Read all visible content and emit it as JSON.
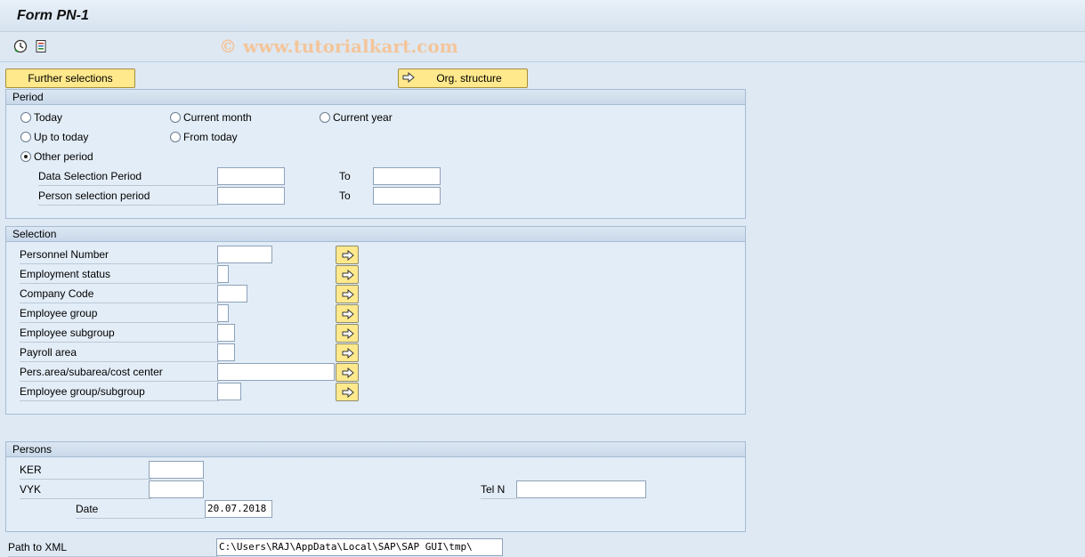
{
  "title": "Form PN-1",
  "watermark": "© www.tutorialkart.com",
  "toolbar": {
    "execute_icon": "execute-clock-icon",
    "variant_icon": "variant-list-icon"
  },
  "buttons": {
    "further_selections": "Further selections",
    "org_structure": "Org. structure"
  },
  "period": {
    "header": "Period",
    "options": {
      "today": "Today",
      "current_month": "Current month",
      "current_year": "Current year",
      "up_to_today": "Up to today",
      "from_today": "From today",
      "other_period": "Other period"
    },
    "selected": "other_period",
    "data_selection_label": "Data Selection Period",
    "person_selection_label": "Person selection period",
    "to_label": "To",
    "data_from": "",
    "data_to": "",
    "person_from": "",
    "person_to": ""
  },
  "selection": {
    "header": "Selection",
    "fields": [
      {
        "label": "Personnel Number",
        "value": ""
      },
      {
        "label": "Employment status",
        "value": ""
      },
      {
        "label": "Company Code",
        "value": ""
      },
      {
        "label": "Employee group",
        "value": ""
      },
      {
        "label": "Employee subgroup",
        "value": ""
      },
      {
        "label": "Payroll area",
        "value": ""
      },
      {
        "label": "Pers.area/subarea/cost center",
        "value": ""
      },
      {
        "label": "Employee group/subgroup",
        "value": ""
      }
    ]
  },
  "persons": {
    "header": "Persons",
    "ker_label": "KER",
    "ker_value": "",
    "vyk_label": "VYK",
    "vyk_value": "",
    "tel_label": "Tel N",
    "tel_value": "",
    "date_label": "Date",
    "date_value": "20.07.2018"
  },
  "path": {
    "label": "Path to XML",
    "value": "C:\\Users\\RAJ\\AppData\\Local\\SAP\\SAP GUI\\tmp\\"
  },
  "colors": {
    "button_yellow": "#ffe98c",
    "background": "#dfe9f4",
    "group_border": "#a5bcd4"
  }
}
